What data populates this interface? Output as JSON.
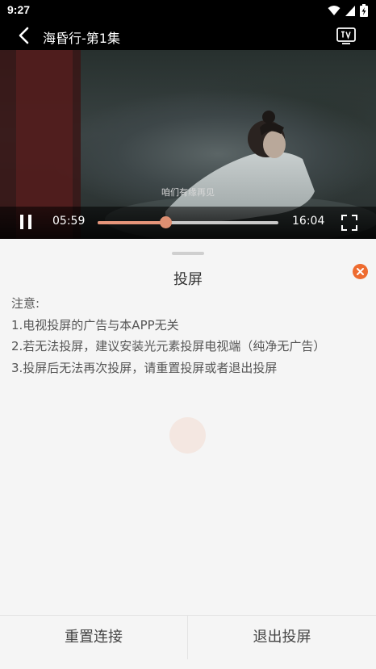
{
  "status_bar": {
    "time": "9:27",
    "icons": [
      "wifi-icon",
      "cell-signal-icon",
      "battery-charging-icon"
    ]
  },
  "player": {
    "title": "海昏行-第1集",
    "subtitle": "咱们有缘再见",
    "current_time": "05:59",
    "total_time": "16:04",
    "progress_fraction": 0.373,
    "state": "playing",
    "icons": {
      "back": "back-arrow-icon",
      "cast": "tv-icon",
      "pause": "pause-icon",
      "fullscreen": "fullscreen-icon"
    },
    "colors": {
      "progress": "#e6957a",
      "handle": "#dd8f72",
      "track": "#c9c9c9"
    }
  },
  "cast_sheet": {
    "title": "投屏",
    "notice_title": "注意:",
    "notices": [
      "1.电视投屏的广告与本APP无关",
      "2.若无法投屏，建议安装光元素投屏电视端（纯净无广告）",
      "3.投屏后无法再次投屏，请重置投屏或者退出投屏"
    ],
    "close_icon": "close-icon",
    "accent_color": "#ee6b2f",
    "buttons": {
      "reconnect": "重置连接",
      "exit": "退出投屏"
    }
  }
}
